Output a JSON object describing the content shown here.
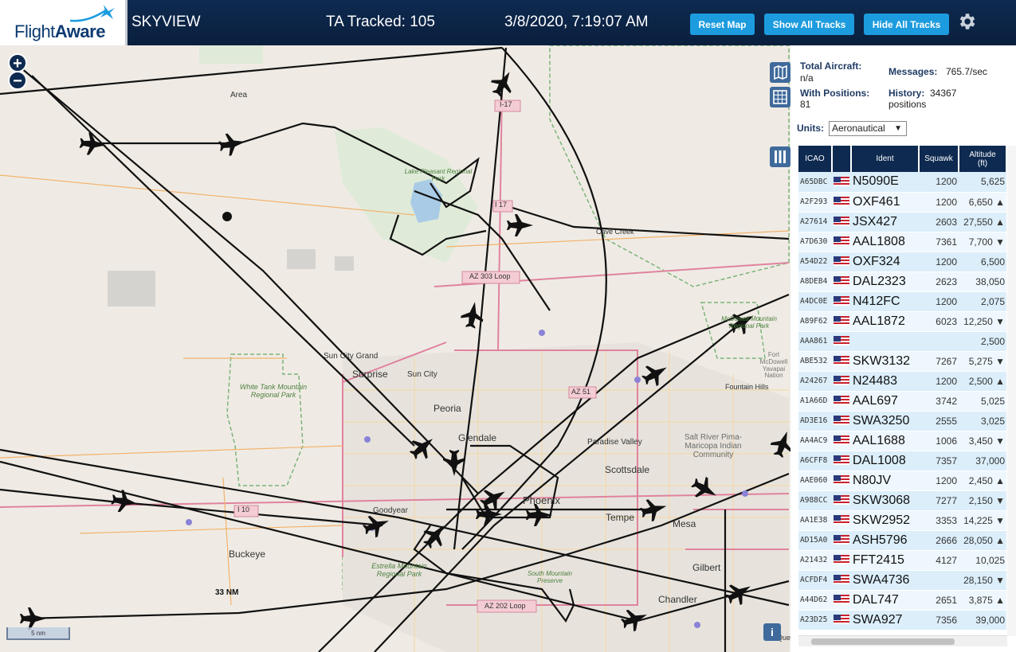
{
  "header": {
    "brand": "FlightAware",
    "site_name": "SKYVIEW",
    "ta_tracked": "TA Tracked: 105",
    "clock": "3/8/2020, 7:19:07 AM",
    "buttons": {
      "reset": "Reset Map",
      "show": "Show All Tracks",
      "hide": "Hide All Tracks"
    }
  },
  "map": {
    "zoom_in": "+",
    "zoom_out": "−",
    "scale_label": "5 nm",
    "range_label": "33 NM",
    "info": "i",
    "places": [
      "Area",
      "I-17",
      "Lake Pleasant Regional Park",
      "I 17",
      "Cave Creek",
      "AZ 303 Loop",
      "McDowell Mountain Regional Park",
      "Fort McDowell Yavapai Nation",
      "Fountain Hills",
      "Sun City Grand",
      "Surprise",
      "Sun City",
      "White Tank Mountain Regional Park",
      "AZ 51",
      "Peoria",
      "Glendale",
      "Paradise Valley",
      "Scottsdale",
      "Salt River Pima-Maricopa Indian Community",
      "I 10",
      "Goodyear",
      "Phoenix",
      "Tempe",
      "Mesa",
      "Buckeye",
      "Estrella Mountain Regional Park",
      "South Mountain Preserve",
      "Gilbert",
      "AZ 202 Loop",
      "Chandler",
      "Que"
    ]
  },
  "stats": {
    "total_aircraft_label": "Total Aircraft:",
    "total_aircraft_value": "n/a",
    "with_positions_label": "With Positions:",
    "with_positions_value": "81",
    "messages_label": "Messages:",
    "messages_value": "765.7/sec",
    "history_label": "History:",
    "history_value_1": "34367",
    "history_value_2": "positions",
    "units_label": "Units:",
    "units_value": "Aeronautical"
  },
  "table": {
    "headers": {
      "icao": "ICAO",
      "ident": "Ident",
      "squawk": "Squawk",
      "alt1": "Altitude",
      "alt2": "(ft)"
    },
    "rows": [
      {
        "icao": "A65DBC",
        "ident": "N5090E",
        "squawk": "1200",
        "alt": "5,625"
      },
      {
        "icao": "A2F293",
        "ident": "OXF461",
        "squawk": "1200",
        "alt": "6,650 ▲"
      },
      {
        "icao": "A27614",
        "ident": "JSX427",
        "squawk": "2603",
        "alt": "27,550 ▲"
      },
      {
        "icao": "A7D630",
        "ident": "AAL1808",
        "squawk": "7361",
        "alt": "7,700 ▼"
      },
      {
        "icao": "A54D22",
        "ident": "OXF324",
        "squawk": "1200",
        "alt": "6,500"
      },
      {
        "icao": "A8DEB4",
        "ident": "DAL2323",
        "squawk": "2623",
        "alt": "38,050"
      },
      {
        "icao": "A4DC0E",
        "ident": "N412FC",
        "squawk": "1200",
        "alt": "2,075"
      },
      {
        "icao": "A89F62",
        "ident": "AAL1872",
        "squawk": "6023",
        "alt": "12,250 ▼"
      },
      {
        "icao": "AAA861",
        "ident": "",
        "squawk": "",
        "alt": "2,500"
      },
      {
        "icao": "ABE532",
        "ident": "SKW3132",
        "squawk": "7267",
        "alt": "5,275 ▼"
      },
      {
        "icao": "A24267",
        "ident": "N24483",
        "squawk": "1200",
        "alt": "2,500 ▲"
      },
      {
        "icao": "A1A66D",
        "ident": "AAL697",
        "squawk": "3742",
        "alt": "5,025"
      },
      {
        "icao": "AD3E16",
        "ident": "SWA3250",
        "squawk": "2555",
        "alt": "3,025"
      },
      {
        "icao": "AA4AC9",
        "ident": "AAL1688",
        "squawk": "1006",
        "alt": "3,450 ▼"
      },
      {
        "icao": "A6CFF8",
        "ident": "DAL1008",
        "squawk": "7357",
        "alt": "37,000"
      },
      {
        "icao": "AAE060",
        "ident": "N80JV",
        "squawk": "1200",
        "alt": "2,450 ▲"
      },
      {
        "icao": "A988CC",
        "ident": "SKW3068",
        "squawk": "7277",
        "alt": "2,150 ▼"
      },
      {
        "icao": "AA1E38",
        "ident": "SKW2952",
        "squawk": "3353",
        "alt": "14,225 ▼"
      },
      {
        "icao": "AD15A0",
        "ident": "ASH5796",
        "squawk": "2666",
        "alt": "28,050 ▲"
      },
      {
        "icao": "A21432",
        "ident": "FFT2415",
        "squawk": "4127",
        "alt": "10,025"
      },
      {
        "icao": "ACFDF4",
        "ident": "SWA4736",
        "squawk": "",
        "alt": "28,150 ▼"
      },
      {
        "icao": "A44D62",
        "ident": "DAL747",
        "squawk": "2651",
        "alt": "3,875 ▲"
      },
      {
        "icao": "A23D25",
        "ident": "SWA927",
        "squawk": "7356",
        "alt": "39,000"
      }
    ]
  },
  "colors": {
    "header_bg": "#0e2a50",
    "button_bg": "#1c9bde",
    "row_odd": "#dbeefa",
    "row_even": "#eef7fd"
  },
  "icons": [
    "plane-logo-icon",
    "gear-icon",
    "map-layers-icon",
    "grid-icon",
    "columns-icon",
    "info-icon",
    "us-flag-icon"
  ]
}
